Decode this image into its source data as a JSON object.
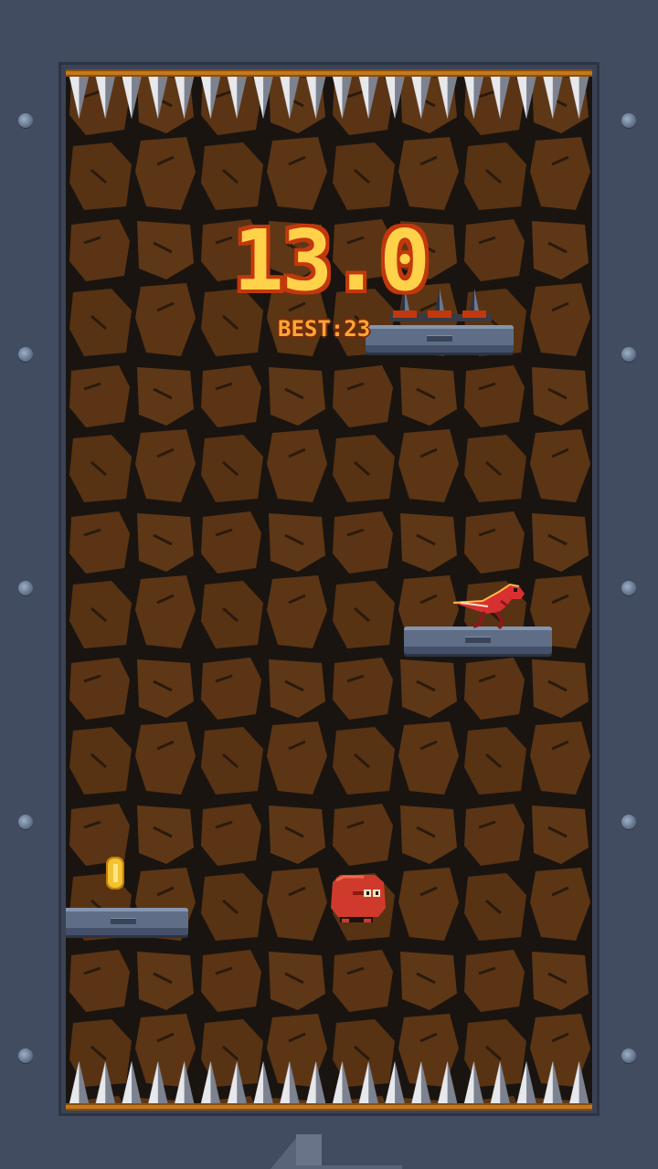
{
  "hud": {
    "score": "13.0",
    "best": "BEST:23"
  },
  "colors": {
    "background": "#424c60",
    "rock": "#5a3414",
    "crack": "#1a1410",
    "platform": "#5f6e86",
    "score_fill": "#ffd24a",
    "score_outline": "#c2380c",
    "coin": "#f2c230",
    "player": "#d03a2c",
    "dino": "#d83030"
  },
  "entities": {
    "player": "red-blob-player",
    "enemy": "red-raptor-dinosaur",
    "pickup": "gold-coin",
    "hazard_top": "ceiling-spikes",
    "hazard_bottom": "floor-spikes"
  },
  "controls": {
    "icon": "arrow-up-icon"
  }
}
